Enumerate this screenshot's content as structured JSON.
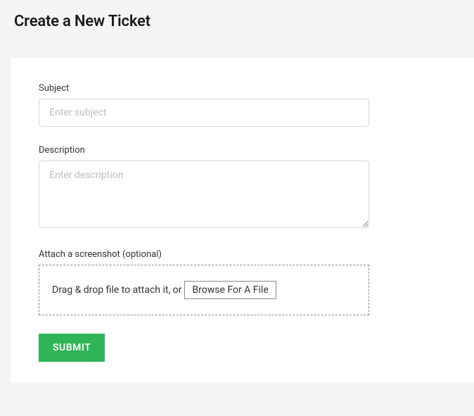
{
  "page": {
    "title": "Create a New Ticket"
  },
  "form": {
    "subject": {
      "label": "Subject",
      "placeholder": "Enter subject",
      "value": ""
    },
    "description": {
      "label": "Description",
      "placeholder": "Enter description",
      "value": ""
    },
    "attachment": {
      "label": "Attach a screenshot (optional)",
      "drop_text": "Drag & drop file to attach it, or ",
      "browse_label": "Browse For A File"
    },
    "submit_label": "SUBMIT"
  }
}
